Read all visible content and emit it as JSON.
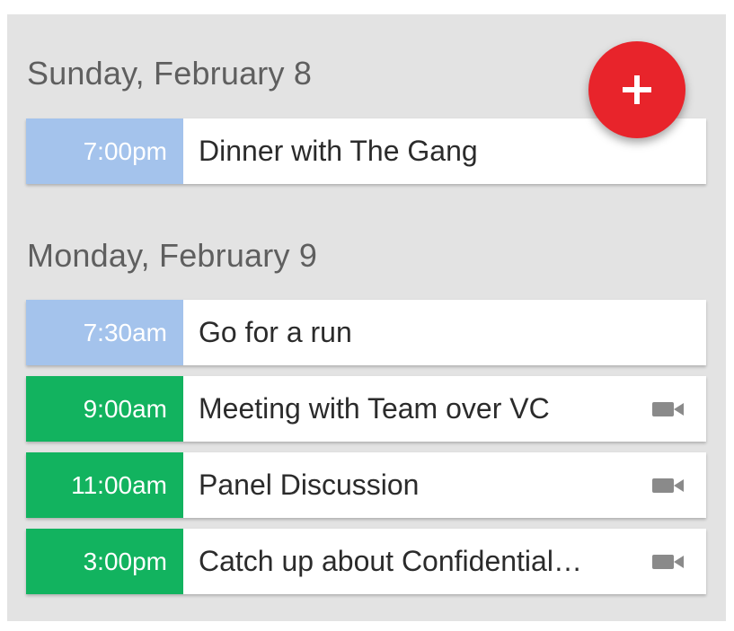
{
  "days": [
    {
      "heading": "Sunday, February 8",
      "events": [
        {
          "time": "7:00pm",
          "title": "Dinner with The Gang",
          "color": "#a4c3ec",
          "video": false
        }
      ]
    },
    {
      "heading": "Monday, February 9",
      "events": [
        {
          "time": "7:30am",
          "title": "Go for a run",
          "color": "#a4c3ec",
          "video": false
        },
        {
          "time": "9:00am",
          "title": "Meeting with Team over VC",
          "color": "#12b35f",
          "video": true
        },
        {
          "time": "11:00am",
          "title": "Panel Discussion",
          "color": "#12b35f",
          "video": true
        },
        {
          "time": "3:00pm",
          "title": "Catch up about Confidential…",
          "color": "#12b35f",
          "video": true
        }
      ]
    }
  ],
  "fab": {
    "icon": "plus-icon",
    "color": "#e8242b"
  },
  "colors": {
    "background": "#e3e3e3",
    "personal": "#a4c3ec",
    "meeting": "#12b35f"
  }
}
